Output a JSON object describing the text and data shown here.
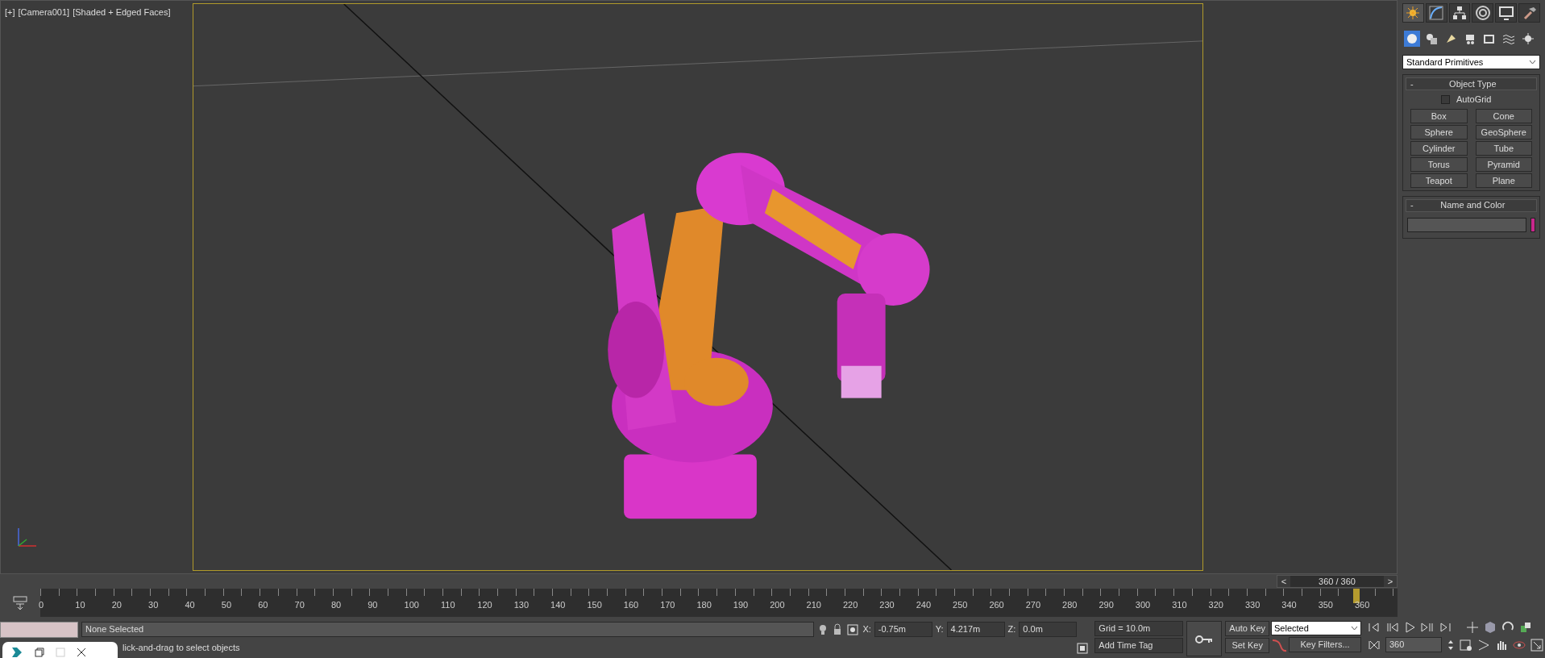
{
  "viewport": {
    "labels": [
      "[+]",
      "[Camera001]",
      "[Shaded + Edged Faces]"
    ]
  },
  "time_slider": {
    "prev": "<",
    "reading": "360 / 360",
    "next": ">",
    "level": 1
  },
  "timeline": {
    "ticks": [
      "0",
      "10",
      "20",
      "30",
      "40",
      "50",
      "60",
      "70",
      "80",
      "90",
      "100",
      "110",
      "120",
      "130",
      "140",
      "150",
      "160",
      "170",
      "180",
      "190",
      "200",
      "210",
      "220",
      "230",
      "240",
      "250",
      "260",
      "270",
      "280",
      "290",
      "300",
      "310",
      "320",
      "330",
      "340",
      "350",
      "360"
    ]
  },
  "command_panel": {
    "tabs": [
      {
        "selected": true
      },
      {
        "selected": false
      },
      {
        "selected": false
      },
      {
        "selected": false
      },
      {
        "selected": false
      },
      {
        "selected": false
      }
    ],
    "categories": [
      {
        "selected": true
      },
      {
        "selected": false
      },
      {
        "selected": false
      },
      {
        "selected": false
      },
      {
        "selected": false
      },
      {
        "selected": false
      },
      {
        "selected": false
      }
    ],
    "dropdown": "Standard Primitives",
    "rollouts": [
      {
        "kind": "buttons",
        "toggle": "-",
        "title": "Object Type",
        "autogrid": {
          "label": "AutoGrid",
          "checked": false
        },
        "buttons": [
          "Box",
          "Cone",
          "Sphere",
          "GeoSphere",
          "Cylinder",
          "Tube",
          "Torus",
          "Pyramid",
          "Teapot",
          "Plane"
        ]
      },
      {
        "kind": "name",
        "toggle": "-",
        "title": "Name and Color",
        "color": "#c8288c"
      }
    ]
  },
  "status_bar": {
    "selection": "None Selected",
    "prompt": "lick-and-drag to select objects",
    "coords": [
      {
        "label": "X:",
        "value": "-0.75m"
      },
      {
        "label": "Y:",
        "value": "4.217m"
      },
      {
        "label": "Z:",
        "value": "0.0m"
      }
    ],
    "grid": "Grid = 10.0m",
    "time_tag": "Add Time Tag",
    "auto_key": "Auto Key",
    "set_key": "Set Key",
    "key_mode": "Selected",
    "key_filters": "Key Filters...",
    "frame": "360"
  }
}
